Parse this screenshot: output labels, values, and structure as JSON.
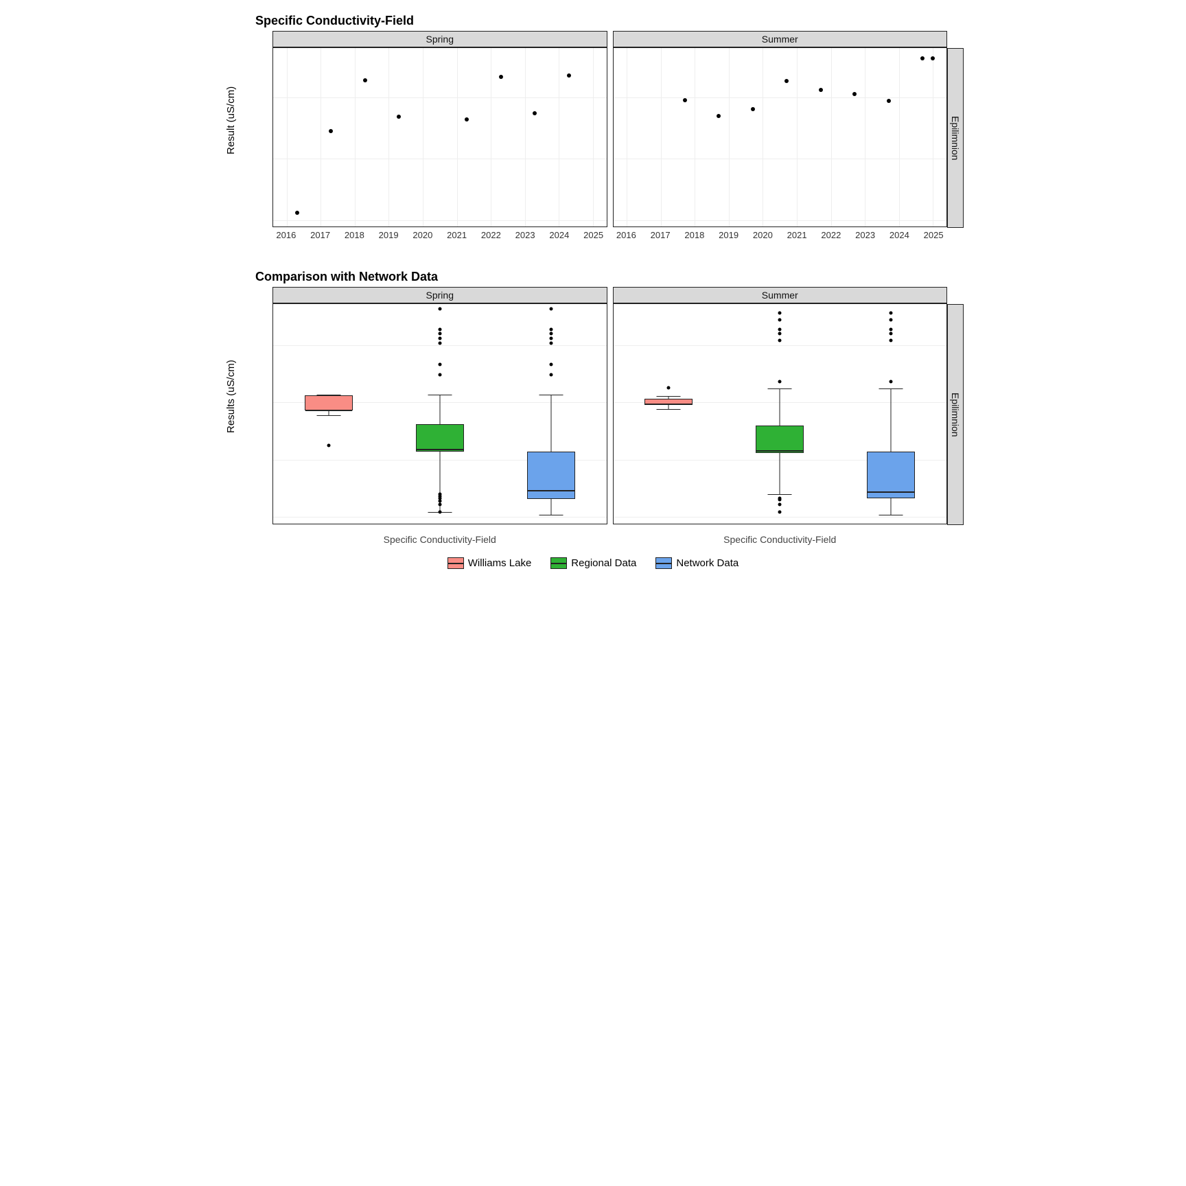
{
  "chart_data": [
    {
      "type": "scatter",
      "title": "Specific Conductivity-Field",
      "ylabel": "Result (uS/cm)",
      "facet_right": "Epilimnion",
      "x_ticks": [
        2016,
        2017,
        2018,
        2019,
        2020,
        2021,
        2022,
        2023,
        2024,
        2025
      ],
      "y_ticks": [
        300,
        400,
        500
      ],
      "xlim": [
        2015.6,
        2025.4
      ],
      "ylim": [
        290,
        580
      ],
      "facets": [
        {
          "label": "Spring",
          "x": [
            2016.3,
            2017.3,
            2018.3,
            2019.3,
            2021.3,
            2022.3,
            2023.3,
            2024.3
          ],
          "y": [
            312,
            445,
            528,
            468,
            464,
            533,
            474,
            535
          ]
        },
        {
          "label": "Summer",
          "x": [
            2017.7,
            2018.7,
            2019.7,
            2020.7,
            2021.7,
            2022.7,
            2023.7,
            2024.7,
            2025.0
          ],
          "y": [
            495,
            470,
            481,
            526,
            512,
            505,
            494,
            563,
            563
          ]
        }
      ]
    },
    {
      "type": "box",
      "title": "Comparison with Network Data",
      "ylabel": "Results (uS/cm)",
      "facet_right": "Epilimnion",
      "x_category_label": "Specific Conductivity-Field",
      "y_ticks": [
        0,
        250,
        500,
        750
      ],
      "ylim": [
        -30,
        930
      ],
      "categories": [
        "Williams Lake",
        "Regional Data",
        "Network Data"
      ],
      "colors": {
        "Williams Lake": "#f98d85",
        "Regional Data": "#2fb135",
        "Network Data": "#6ba3eb"
      },
      "facets": [
        {
          "label": "Spring",
          "boxes": [
            {
              "name": "Williams Lake",
              "min": 445,
              "q1": 465,
              "median": 471,
              "q3": 530,
              "max": 535,
              "outliers": [
                312
              ]
            },
            {
              "name": "Regional Data",
              "min": 22,
              "q1": 285,
              "median": 300,
              "q3": 405,
              "max": 535,
              "outliers": [
                22,
                55,
                70,
                80,
                90,
                100,
                620,
                665,
                760,
                780,
                800,
                820,
                910
              ]
            },
            {
              "name": "Network Data",
              "min": 10,
              "q1": 78,
              "median": 120,
              "q3": 285,
              "max": 535,
              "outliers": [
                620,
                665,
                760,
                780,
                800,
                820,
                910
              ]
            }
          ]
        },
        {
          "label": "Summer",
          "boxes": [
            {
              "name": "Williams Lake",
              "min": 470,
              "q1": 490,
              "median": 498,
              "q3": 515,
              "max": 528,
              "outliers": [
                563
              ]
            },
            {
              "name": "Regional Data",
              "min": 100,
              "q1": 280,
              "median": 295,
              "q3": 400,
              "max": 560,
              "outliers": [
                22,
                55,
                75,
                80,
                590,
                770,
                800,
                820,
                860,
                890
              ]
            },
            {
              "name": "Network Data",
              "min": 8,
              "q1": 80,
              "median": 115,
              "q3": 285,
              "max": 560,
              "outliers": [
                590,
                770,
                800,
                820,
                860,
                890
              ]
            }
          ]
        }
      ]
    }
  ],
  "legend": {
    "items": [
      "Williams Lake",
      "Regional Data",
      "Network Data"
    ]
  }
}
